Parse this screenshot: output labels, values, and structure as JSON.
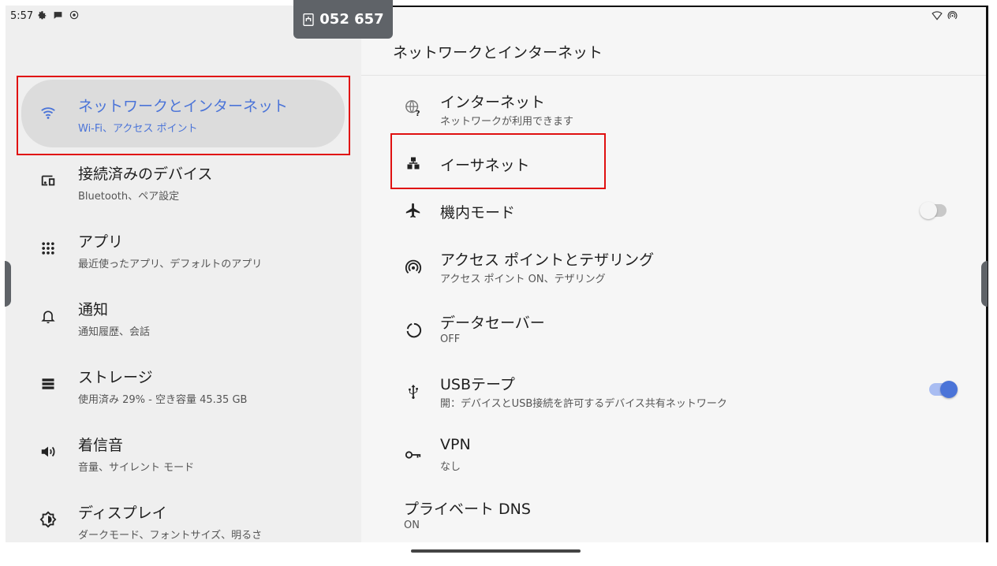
{
  "status_bar": {
    "time": "5:57"
  },
  "pin_badge": {
    "code": "052 657"
  },
  "left_menu": {
    "items": [
      {
        "title": "ネットワークとインターネット",
        "subtitle": "Wi-Fi、アクセス ポイント",
        "icon": "wifi-icon",
        "selected": true
      },
      {
        "title": "接続済みのデバイス",
        "subtitle": "Bluetooth、ペア設定",
        "icon": "devices-icon"
      },
      {
        "title": "アプリ",
        "subtitle": "最近使ったアプリ、デフォルトのアプリ",
        "icon": "apps-grid-icon"
      },
      {
        "title": "通知",
        "subtitle": "通知履歴、会話",
        "icon": "bell-icon"
      },
      {
        "title": "ストレージ",
        "subtitle": "使用済み 29% - 空き容量 45.35 GB",
        "icon": "storage-icon"
      },
      {
        "title": "着信音",
        "subtitle": "音量、サイレント モード",
        "icon": "volume-icon"
      },
      {
        "title": "ディスプレイ",
        "subtitle": "ダークモード、フォントサイズ、明るさ",
        "icon": "brightness-icon"
      }
    ]
  },
  "right_panel": {
    "header": "ネットワークとインターネット",
    "items": [
      {
        "title": "インターネット",
        "subtitle": "ネットワークが利用できます",
        "icon": "globe-question-icon"
      },
      {
        "title": "イーサネット",
        "icon": "ethernet-icon"
      },
      {
        "title": "機内モード",
        "icon": "airplane-icon",
        "toggle": false
      },
      {
        "title": "アクセス ポイントとテザリング",
        "subtitle": "アクセス ポイント ON、テザリング",
        "icon": "hotspot-icon"
      },
      {
        "title": "データセーバー",
        "subtitle": "OFF",
        "icon": "data-saver-icon"
      },
      {
        "title": "USBテープ",
        "subtitle": "開：デバイスとUSB接続を許可するデバイス共有ネットワーク",
        "icon": "usb-icon",
        "toggle": true
      },
      {
        "title": "VPN",
        "subtitle": "なし",
        "icon": "vpn-key-icon"
      },
      {
        "title": "プライベート DNS",
        "subtitle": "ON"
      }
    ]
  },
  "colors": {
    "accent": "#4b74d8",
    "highlight": "#e01010",
    "selected_bg": "#dcdcdc"
  }
}
